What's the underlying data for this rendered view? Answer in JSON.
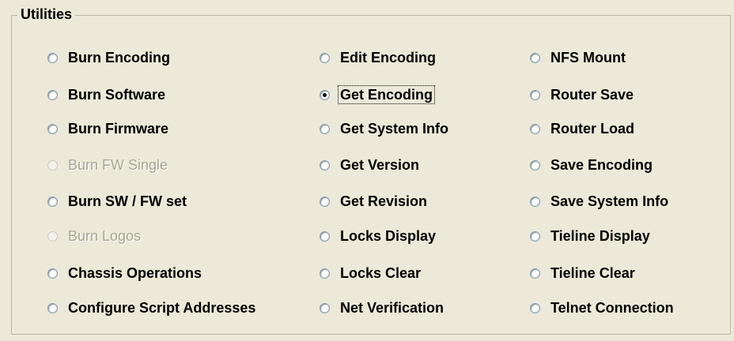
{
  "group": {
    "title": "Utilities"
  },
  "columns": [
    [
      {
        "label": "Burn Encoding",
        "checked": false,
        "enabled": true
      },
      {
        "label": "Burn Software",
        "checked": false,
        "enabled": true
      },
      {
        "label": "Burn Firmware",
        "checked": false,
        "enabled": true
      },
      {
        "label": "Burn FW Single",
        "checked": false,
        "enabled": false
      },
      {
        "label": "Burn SW / FW set",
        "checked": false,
        "enabled": true
      },
      {
        "label": "Burn Logos",
        "checked": false,
        "enabled": false
      },
      {
        "label": "Chassis Operations",
        "checked": false,
        "enabled": true
      },
      {
        "label": "Configure Script Addresses",
        "checked": false,
        "enabled": true
      }
    ],
    [
      {
        "label": "Edit Encoding",
        "checked": false,
        "enabled": true
      },
      {
        "label": "Get Encoding",
        "checked": true,
        "enabled": true
      },
      {
        "label": "Get System Info",
        "checked": false,
        "enabled": true
      },
      {
        "label": "Get Version",
        "checked": false,
        "enabled": true
      },
      {
        "label": "Get Revision",
        "checked": false,
        "enabled": true
      },
      {
        "label": "Locks Display",
        "checked": false,
        "enabled": true
      },
      {
        "label": "Locks Clear",
        "checked": false,
        "enabled": true
      },
      {
        "label": "Net Verification",
        "checked": false,
        "enabled": true
      }
    ],
    [
      {
        "label": "NFS Mount",
        "checked": false,
        "enabled": true
      },
      {
        "label": "Router Save",
        "checked": false,
        "enabled": true
      },
      {
        "label": "Router Load",
        "checked": false,
        "enabled": true
      },
      {
        "label": "Save Encoding",
        "checked": false,
        "enabled": true
      },
      {
        "label": "Save System Info",
        "checked": false,
        "enabled": true
      },
      {
        "label": "Tieline Display",
        "checked": false,
        "enabled": true
      },
      {
        "label": "Tieline Clear",
        "checked": false,
        "enabled": true
      },
      {
        "label": "Telnet Connection",
        "checked": false,
        "enabled": true
      }
    ]
  ]
}
